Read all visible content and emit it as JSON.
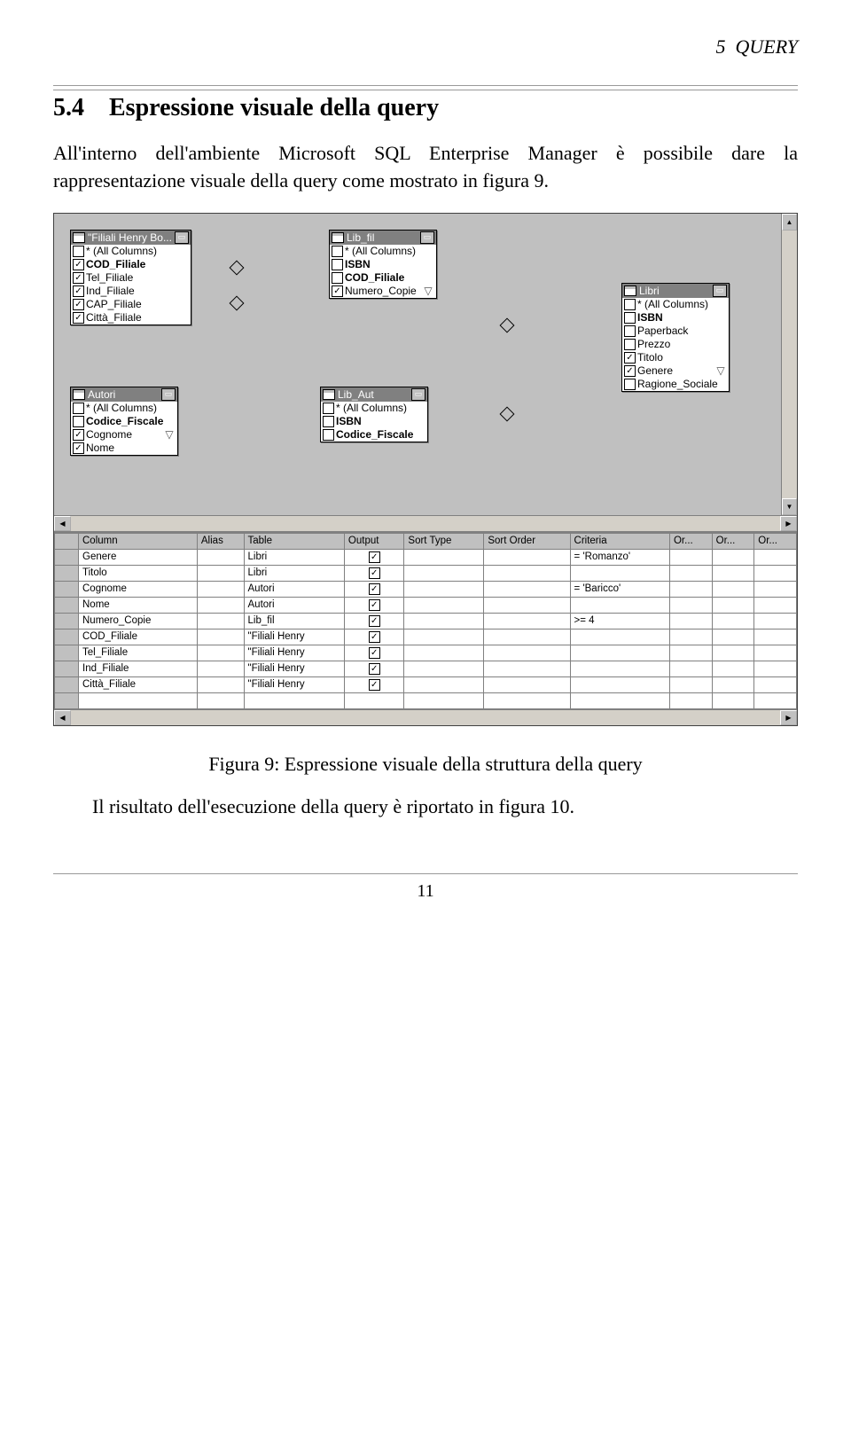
{
  "header": {
    "section": "5",
    "label": "QUERY"
  },
  "section": {
    "number": "5.4",
    "title": "Espressione visuale della query"
  },
  "paragraph1": "All'interno dell'ambiente Microsoft SQL Enterprise Manager è possibile dare la rappresentazione visuale della query come mostrato in figura 9.",
  "figure_caption": "Figura 9: Espressione visuale della struttura della query",
  "paragraph2": "Il risultato dell'esecuzione della query è riportato in figura 10.",
  "page_number": "11",
  "designer": {
    "tables": {
      "filiali": {
        "title": "\"Filiali Henry Bo...",
        "fields": [
          {
            "label": "* (All Columns)",
            "checked": false
          },
          {
            "label": "COD_Filiale",
            "checked": true,
            "bold": true
          },
          {
            "label": "Tel_Filiale",
            "checked": true
          },
          {
            "label": "Ind_Filiale",
            "checked": true
          },
          {
            "label": "CAP_Filiale",
            "checked": true
          },
          {
            "label": "Città_Filiale",
            "checked": true
          }
        ]
      },
      "lib_fil": {
        "title": "Lib_fil",
        "fields": [
          {
            "label": "* (All Columns)",
            "checked": false
          },
          {
            "label": "ISBN",
            "checked": false,
            "bold": true
          },
          {
            "label": "COD_Filiale",
            "checked": false,
            "bold": true
          },
          {
            "label": "Numero_Copie",
            "checked": true,
            "filter": true
          }
        ]
      },
      "libri": {
        "title": "Libri",
        "fields": [
          {
            "label": "* (All Columns)",
            "checked": false
          },
          {
            "label": "ISBN",
            "checked": false,
            "bold": true
          },
          {
            "label": "Paperback",
            "checked": false
          },
          {
            "label": "Prezzo",
            "checked": false
          },
          {
            "label": "Titolo",
            "checked": true
          },
          {
            "label": "Genere",
            "checked": true,
            "filter": true
          },
          {
            "label": "Ragione_Sociale",
            "checked": false
          }
        ]
      },
      "autori": {
        "title": "Autori",
        "fields": [
          {
            "label": "* (All Columns)",
            "checked": false
          },
          {
            "label": "Codice_Fiscale",
            "checked": false,
            "bold": true
          },
          {
            "label": "Cognome",
            "checked": true,
            "filter": true
          },
          {
            "label": "Nome",
            "checked": true
          }
        ]
      },
      "lib_aut": {
        "title": "Lib_Aut",
        "fields": [
          {
            "label": "* (All Columns)",
            "checked": false
          },
          {
            "label": "ISBN",
            "checked": false,
            "bold": true
          },
          {
            "label": "Codice_Fiscale",
            "checked": false,
            "bold": true
          }
        ]
      }
    },
    "grid": {
      "headers": [
        "Column",
        "Alias",
        "Table",
        "Output",
        "Sort Type",
        "Sort Order",
        "Criteria",
        "Or...",
        "Or...",
        "Or..."
      ],
      "rows": [
        {
          "col": "Genere",
          "alias": "",
          "table": "Libri",
          "output": true,
          "sorttype": "",
          "sortorder": "",
          "criteria": "= 'Romanzo'",
          "or1": "",
          "or2": "",
          "or3": ""
        },
        {
          "col": "Titolo",
          "alias": "",
          "table": "Libri",
          "output": true,
          "sorttype": "",
          "sortorder": "",
          "criteria": "",
          "or1": "",
          "or2": "",
          "or3": ""
        },
        {
          "col": "Cognome",
          "alias": "",
          "table": "Autori",
          "output": true,
          "sorttype": "",
          "sortorder": "",
          "criteria": "= 'Baricco'",
          "or1": "",
          "or2": "",
          "or3": ""
        },
        {
          "col": "Nome",
          "alias": "",
          "table": "Autori",
          "output": true,
          "sorttype": "",
          "sortorder": "",
          "criteria": "",
          "or1": "",
          "or2": "",
          "or3": ""
        },
        {
          "col": "Numero_Copie",
          "alias": "",
          "table": "Lib_fil",
          "output": true,
          "sorttype": "",
          "sortorder": "",
          "criteria": ">= 4",
          "or1": "",
          "or2": "",
          "or3": ""
        },
        {
          "col": "COD_Filiale",
          "alias": "",
          "table": "\"Filiali Henry",
          "output": true,
          "sorttype": "",
          "sortorder": "",
          "criteria": "",
          "or1": "",
          "or2": "",
          "or3": ""
        },
        {
          "col": "Tel_Filiale",
          "alias": "",
          "table": "\"Filiali Henry",
          "output": true,
          "sorttype": "",
          "sortorder": "",
          "criteria": "",
          "or1": "",
          "or2": "",
          "or3": ""
        },
        {
          "col": "Ind_Filiale",
          "alias": "",
          "table": "\"Filiali Henry",
          "output": true,
          "sorttype": "",
          "sortorder": "",
          "criteria": "",
          "or1": "",
          "or2": "",
          "or3": ""
        },
        {
          "col": "Città_Filiale",
          "alias": "",
          "table": "\"Filiali Henry",
          "output": true,
          "sorttype": "",
          "sortorder": "",
          "criteria": "",
          "or1": "",
          "or2": "",
          "or3": ""
        }
      ]
    }
  }
}
